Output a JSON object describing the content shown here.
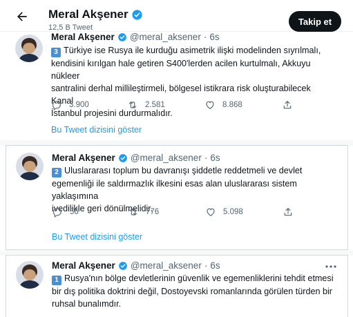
{
  "header": {
    "name": "Meral Akşener",
    "tweet_count": "12,5 B Tweet",
    "follow_label": "Takip et"
  },
  "colors": {
    "verified": "#1d9bf0",
    "link": "#1d9bf0",
    "number_badge": "#4a8ed4",
    "follow_button": "#0f1419"
  },
  "tweets": [
    {
      "name": "Meral Akşener",
      "handle": "@meral_aksener",
      "dot": "·",
      "time": "6s",
      "number": "3",
      "lines": [
        "Türkiye ise Rusya ile kurduğu asimetrik ilişki modelinden sıyrılmalı,",
        "kendisini kırılgan hale getiren S400'lerden acilen kurtulmalı, Akkuyu nükleer",
        "santralini derhal millileştirmeli, bölgesel istikrara risk oluşturabilecek Kanal",
        "İstanbul projesini durdurmalıdır."
      ],
      "replies": "3.900",
      "retweets": "2.581",
      "likes": "8.868",
      "show_thread": "Bu Tweet dizisini göster"
    },
    {
      "name": "Meral Akşener",
      "handle": "@meral_aksener",
      "dot": "·",
      "time": "6s",
      "number": "2",
      "lines": [
        "Uluslararası toplum bu davranışı şiddetle reddetmeli ve devlet",
        "egemenliği ile saldırmazlık ilkesini esas alan uluslararası sistem yaklaşımına",
        "ivedilikle geri dönülmelidir."
      ],
      "replies": "56",
      "retweets": "776",
      "likes": "5.098",
      "show_thread": "Bu Tweet dizisini göster"
    },
    {
      "name": "Meral Akşener",
      "handle": "@meral_aksener",
      "dot": "·",
      "time": "6s",
      "number": "1",
      "lines": [
        "Rusya'nın bölge devletlerinin güvenlik ve egemenliklerini tehdit etmesi",
        "bir dış politika doktrini değil, Dostoyevski romanlarında görülen türden bir",
        "ruhsal bunalımdır."
      ]
    }
  ],
  "icons": {
    "back": "arrow-left-icon",
    "verified": "verified-badge-icon",
    "more": "more-dots-icon",
    "reply": "reply-icon",
    "retweet": "retweet-icon",
    "like": "heart-icon",
    "share": "share-icon"
  }
}
